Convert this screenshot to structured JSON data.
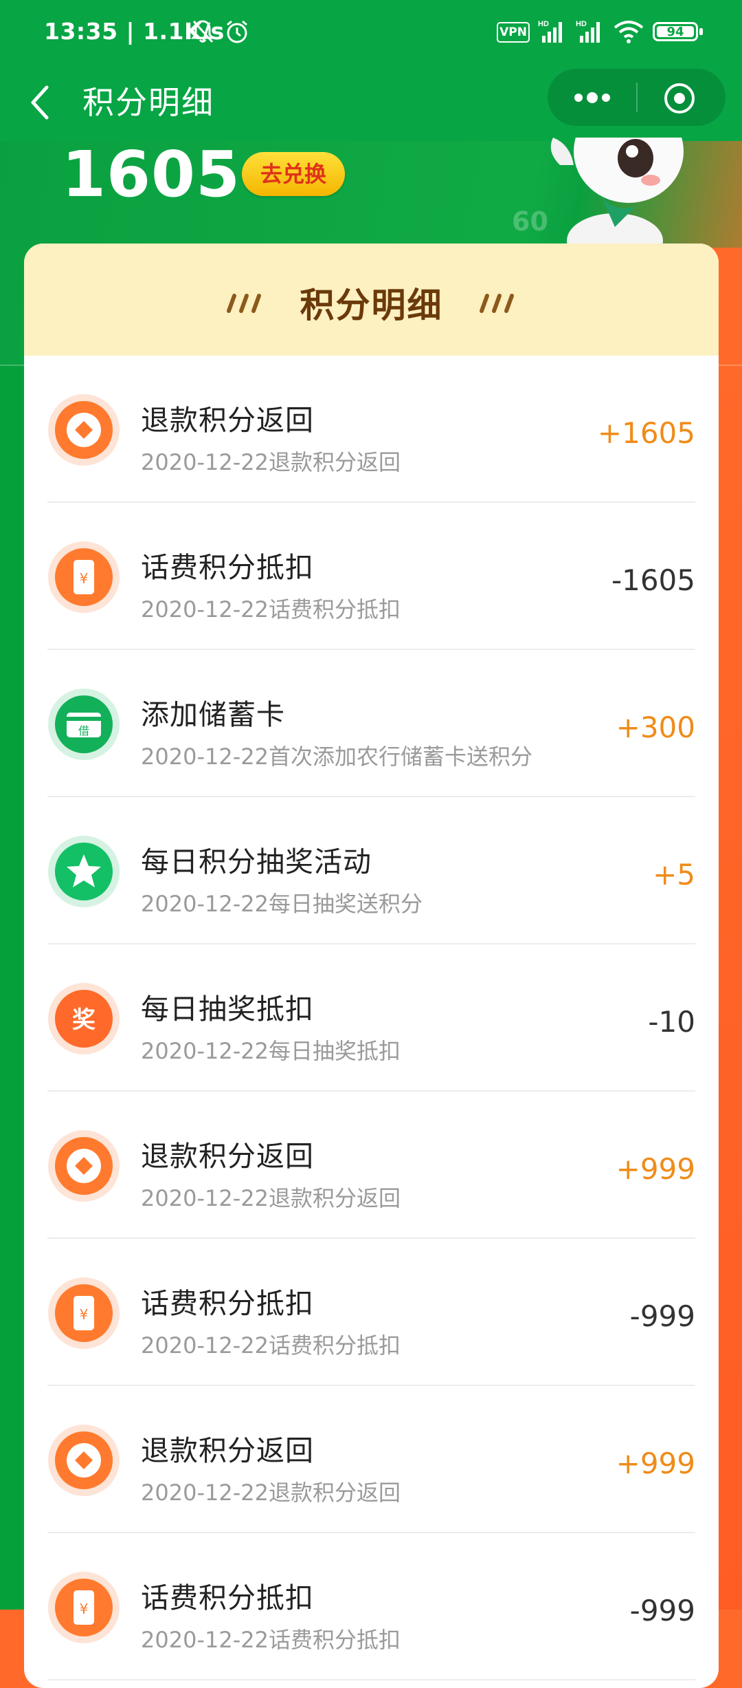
{
  "status": {
    "time": "13:35 | 1.1K/s",
    "vpn": "VPN",
    "battery": "94"
  },
  "nav": {
    "title": "积分明细"
  },
  "header": {
    "points": "1605",
    "redeem_label": "去兑换",
    "faint_number": "60"
  },
  "card": {
    "title": "积分明细"
  },
  "colors": {
    "brand_green": "#07a544",
    "orange": "#ff6a2a",
    "positive": "#ef8c1a"
  },
  "records": [
    {
      "icon": "coin-icon",
      "title": "退款积分返回",
      "sub": "2020-12-22退款积分返回",
      "amount": "+1605",
      "sign": "pos"
    },
    {
      "icon": "phone-bill-icon",
      "title": "话费积分抵扣",
      "sub": "2020-12-22话费积分抵扣",
      "amount": "-1605",
      "sign": "neg"
    },
    {
      "icon": "debit-card-icon",
      "title": "添加储蓄卡",
      "sub": "2020-12-22首次添加农行储蓄卡送积分",
      "amount": "+300",
      "sign": "pos"
    },
    {
      "icon": "star-icon",
      "title": "每日积分抽奖活动",
      "sub": "2020-12-22每日抽奖送积分",
      "amount": "+5",
      "sign": "pos"
    },
    {
      "icon": "lottery-icon",
      "title": "每日抽奖抵扣",
      "sub": "2020-12-22每日抽奖抵扣",
      "amount": "-10",
      "sign": "neg"
    },
    {
      "icon": "coin-icon",
      "title": "退款积分返回",
      "sub": "2020-12-22退款积分返回",
      "amount": "+999",
      "sign": "pos"
    },
    {
      "icon": "phone-bill-icon",
      "title": "话费积分抵扣",
      "sub": "2020-12-22话费积分抵扣",
      "amount": "-999",
      "sign": "neg"
    },
    {
      "icon": "coin-icon",
      "title": "退款积分返回",
      "sub": "2020-12-22退款积分返回",
      "amount": "+999",
      "sign": "pos"
    },
    {
      "icon": "phone-bill-icon",
      "title": "话费积分抵扣",
      "sub": "2020-12-22话费积分抵扣",
      "amount": "-999",
      "sign": "neg"
    }
  ]
}
